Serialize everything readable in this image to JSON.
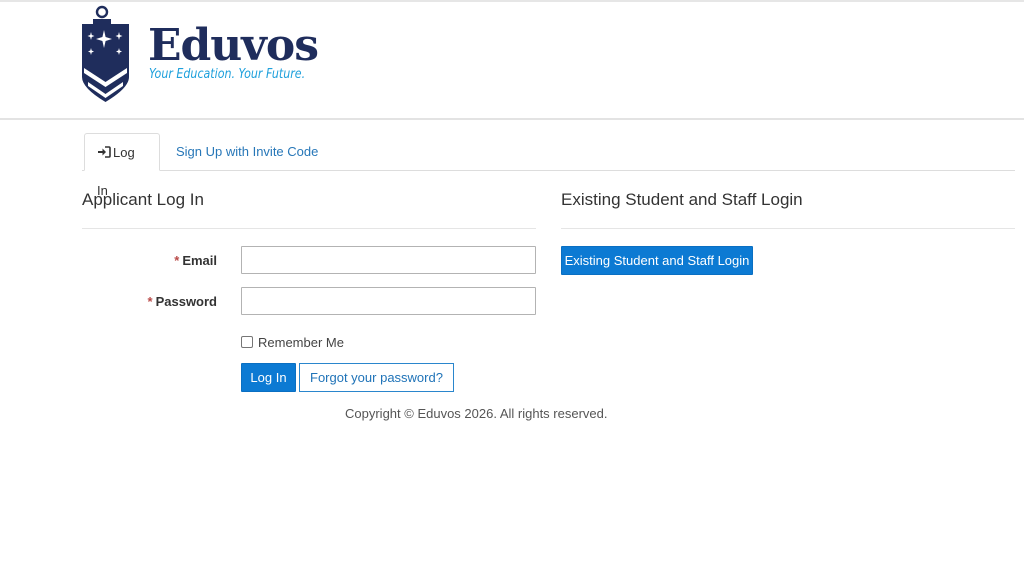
{
  "brand": {
    "name": "Eduvos",
    "tagline": "Your Education. Your Future.",
    "primary_color": "#1f2d5c",
    "accent_color": "#1ea0dc"
  },
  "tabs": [
    {
      "label": "Log In",
      "icon": "sign-in-icon",
      "active": true
    },
    {
      "label": "Sign Up with Invite Code",
      "active": false
    }
  ],
  "applicant": {
    "title": "Applicant Log In",
    "email_label": "Email",
    "email_value": "",
    "password_label": "Password",
    "password_value": "",
    "required_marker": "*",
    "remember_label": "Remember Me",
    "remember_checked": false,
    "login_button": "Log In",
    "forgot_button": "Forgot your password?"
  },
  "staff": {
    "title": "Existing Student and Staff Login",
    "button": "Existing Student and Staff Login"
  },
  "footer": {
    "copyright": "Copyright © Eduvos 2026. All rights reserved."
  },
  "colors": {
    "button_blue": "#0c7ad3",
    "link_blue": "#2777b8",
    "required_red": "#b94a48"
  }
}
